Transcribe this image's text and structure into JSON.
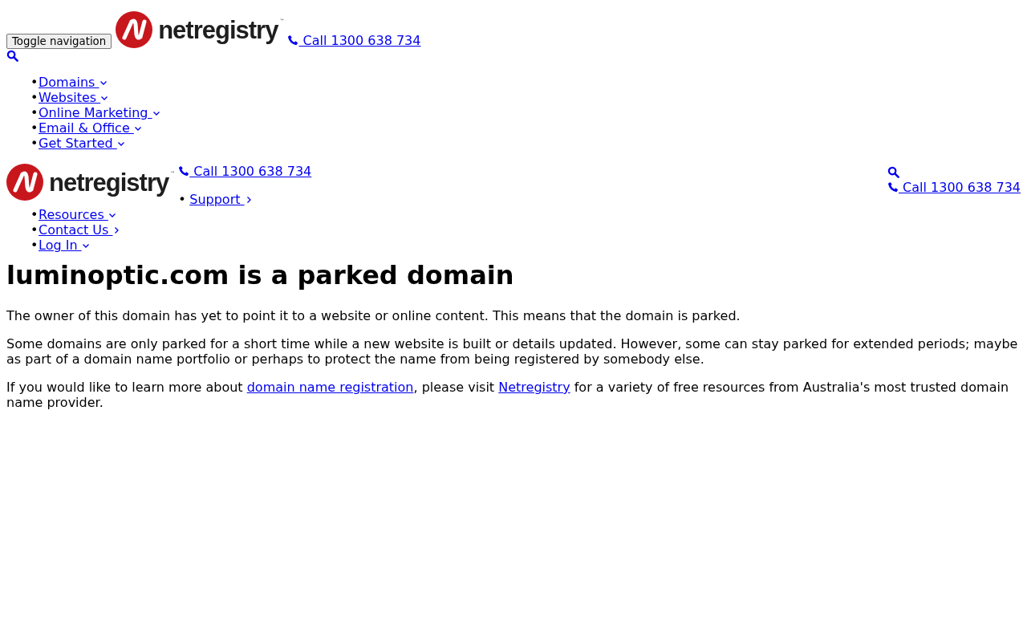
{
  "header": {
    "toggle_button": "Toggle navigation",
    "logo": {
      "wordmark": "netregistry",
      "trademark": "™"
    },
    "call_link": "Call 1300 638 734"
  },
  "nav": [
    {
      "bullet": "•",
      "label": "Domains",
      "kind": "dropdown"
    },
    {
      "bullet": "•",
      "label": "Websites",
      "kind": "dropdown"
    },
    {
      "bullet": "•",
      "label": "Online Marketing",
      "kind": "dropdown"
    },
    {
      "bullet": "•",
      "label": "Email & Office",
      "kind": "dropdown"
    },
    {
      "bullet": "•",
      "label": "Get Started",
      "kind": "dropdown"
    }
  ],
  "secondary_header": {
    "logo": {
      "wordmark": "netregistry",
      "trademark": "™"
    },
    "call_link": "Call 1300 638 734",
    "support_link": {
      "bullet": "•",
      "label": "Support",
      "kind": "page"
    },
    "side_call_link": "Call 1300 638 734"
  },
  "nav_2": [
    {
      "bullet": "•",
      "label": "Resources",
      "kind": "dropdown"
    },
    {
      "bullet": "•",
      "label": "Contact Us",
      "kind": "page"
    },
    {
      "bullet": "•",
      "label": "Log In",
      "kind": "dropdown"
    }
  ],
  "content": {
    "title": "luminoptic.com is a parked domain",
    "paragraphs": [
      [
        {
          "text": "The owner of this domain has yet to point it to a website or online content. This means that the domain is parked.",
          "link": false
        }
      ],
      [
        {
          "text": "Some domains are only parked for a short time while a new website is built or details updated. However, some can stay parked for extended periods; maybe as part of a domain name portfolio or perhaps to protect the name from being registered by somebody else.",
          "link": false
        }
      ],
      [
        {
          "text": "If you would like to learn more about ",
          "link": false
        },
        {
          "text": "domain name registration",
          "link": true
        },
        {
          "text": ", please visit ",
          "link": false
        },
        {
          "text": "Netregistry",
          "link": true
        },
        {
          "text": " for a variety of free resources from Australia's most trusted domain name provider.",
          "link": false
        }
      ]
    ]
  }
}
